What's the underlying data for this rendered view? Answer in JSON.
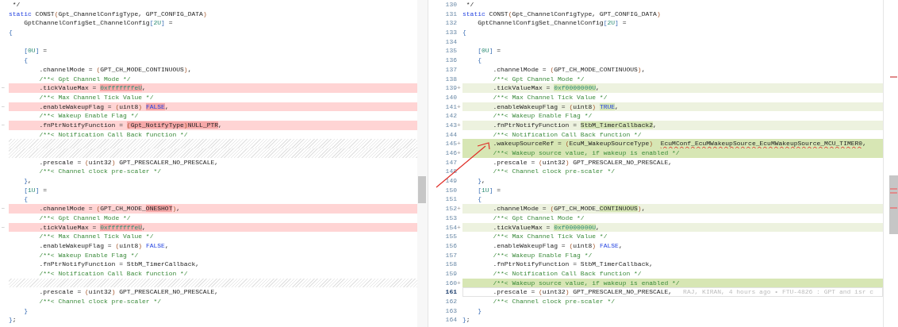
{
  "left_pane": {
    "lines": [
      {
        "kind": "plain",
        "text": " */"
      },
      {
        "kind": "plain",
        "text": "static CONST(Gpt_ChannelConfigType, GPT_CONFIG_DATA)"
      },
      {
        "kind": "plain",
        "text": "    GptChannelConfigSet_ChannelConfig[2U] ="
      },
      {
        "kind": "plain",
        "text": "{"
      },
      {
        "kind": "plain"
      },
      {
        "kind": "plain",
        "text": "    [0U] ="
      },
      {
        "kind": "plain",
        "text": "    {"
      },
      {
        "kind": "plain",
        "text": "        .channelMode = (GPT_CH_MODE_CONTINUOUS),"
      },
      {
        "kind": "plain",
        "text": "        /**< Gpt Channel Mode */"
      },
      {
        "marker": "—",
        "kind": "removed",
        "segments": [
          {
            "text": "        .tickValueMax = ",
            "changed": false
          },
          {
            "text": "0xfffffffeU",
            "changed": true
          },
          {
            "text": ",",
            "changed": false
          }
        ]
      },
      {
        "kind": "plain",
        "text": "        /**< Max Channel Tick Value */"
      },
      {
        "marker": "—",
        "kind": "removed",
        "segments": [
          {
            "text": "        .enableWakeupFlag = (uint8) ",
            "changed": false
          },
          {
            "text": "FALSE",
            "changed": true
          },
          {
            "text": ",",
            "changed": false
          }
        ]
      },
      {
        "kind": "plain",
        "text": "        /**< Wakeup Enable Flag */"
      },
      {
        "marker": "—",
        "kind": "removed",
        "segments": [
          {
            "text": "        .fnPtrNotifyFunction = ",
            "changed": false
          },
          {
            "text": "(Gpt_NotifyType)NULL_PTR",
            "changed": true
          },
          {
            "text": ",",
            "changed": false
          }
        ]
      },
      {
        "kind": "plain",
        "text": "        /**< Notification Call Back function */"
      },
      {
        "kind": "filler"
      },
      {
        "kind": "filler"
      },
      {
        "kind": "plain",
        "text": "        .prescale = (uint32) GPT_PRESCALER_NO_PRESCALE,"
      },
      {
        "kind": "plain",
        "text": "        /**< Channel clock pre-scaler */"
      },
      {
        "kind": "plain",
        "text": "    },"
      },
      {
        "kind": "plain",
        "text": "    [1U] ="
      },
      {
        "kind": "plain",
        "text": "    {"
      },
      {
        "marker": "—",
        "kind": "removed",
        "segments": [
          {
            "text": "        .channelMode = (GPT_CH_MODE_",
            "changed": false
          },
          {
            "text": "ONESHOT",
            "changed": true
          },
          {
            "text": "),",
            "changed": false
          }
        ]
      },
      {
        "kind": "plain",
        "text": "        /**< Gpt Channel Mode */"
      },
      {
        "marker": "—",
        "kind": "removed",
        "segments": [
          {
            "text": "        .tickValueMax = ",
            "changed": false
          },
          {
            "text": "0xfffffffeU",
            "changed": true
          },
          {
            "text": ",",
            "changed": false
          }
        ]
      },
      {
        "kind": "plain",
        "text": "        /**< Max Channel Tick Value */"
      },
      {
        "kind": "plain",
        "text": "        .enableWakeupFlag = (uint8) FALSE,"
      },
      {
        "kind": "plain",
        "text": "        /**< Wakeup Enable Flag */"
      },
      {
        "kind": "plain",
        "text": "        .fnPtrNotifyFunction = StbM_TimerCallback,"
      },
      {
        "kind": "plain",
        "text": "        /**< Notification Call Back function */"
      },
      {
        "kind": "filler"
      },
      {
        "kind": "plain",
        "text": "        .prescale = (uint32) GPT_PRESCALER_NO_PRESCALE,"
      },
      {
        "kind": "plain",
        "text": "        /**< Channel clock pre-scaler */"
      },
      {
        "kind": "plain",
        "text": "    }"
      },
      {
        "kind": "plain",
        "text": "};"
      }
    ]
  },
  "right_pane": {
    "lines": [
      {
        "number": "130",
        "kind": "plain",
        "text": " */"
      },
      {
        "number": "131",
        "kind": "plain",
        "text": "static CONST(Gpt_ChannelConfigType, GPT_CONFIG_DATA)"
      },
      {
        "number": "132",
        "kind": "plain",
        "text": "    GptChannelConfigSet_ChannelConfig[2U] ="
      },
      {
        "number": "133",
        "kind": "plain",
        "text": "{"
      },
      {
        "number": "134",
        "kind": "plain"
      },
      {
        "number": "135",
        "kind": "plain",
        "text": "    [0U] ="
      },
      {
        "number": "136",
        "kind": "plain",
        "text": "    {"
      },
      {
        "number": "137",
        "kind": "plain",
        "text": "        .channelMode = (GPT_CH_MODE_CONTINUOUS),"
      },
      {
        "number": "138",
        "kind": "plain",
        "text": "        /**< Gpt Channel Mode */"
      },
      {
        "number": "139",
        "marker": "+",
        "kind": "added",
        "segments": [
          {
            "text": "        .tickValueMax = ",
            "changed": false
          },
          {
            "text": "0xf0000000U",
            "changed": true
          },
          {
            "text": ",",
            "changed": false
          }
        ]
      },
      {
        "number": "140",
        "kind": "plain",
        "text": "        /**< Max Channel Tick Value */"
      },
      {
        "number": "141",
        "marker": "+",
        "kind": "added",
        "segments": [
          {
            "text": "        .enableWakeupFlag = (uint8) ",
            "changed": false
          },
          {
            "text": "TRUE",
            "changed": true
          },
          {
            "text": ",",
            "changed": false
          }
        ]
      },
      {
        "number": "142",
        "kind": "plain",
        "text": "        /**< Wakeup Enable Flag */"
      },
      {
        "number": "143",
        "marker": "+",
        "kind": "added",
        "segments": [
          {
            "text": "        .fnPtrNotifyFunction = ",
            "changed": false
          },
          {
            "text": "StbM_TimerCallback2",
            "changed": true
          },
          {
            "text": ",",
            "changed": false
          }
        ]
      },
      {
        "number": "144",
        "kind": "plain",
        "text": "        /**< Notification Call Back function */"
      },
      {
        "number": "145",
        "marker": "+",
        "kind": "inserted",
        "segments": [
          {
            "text": "        .wakeupSourceRef = (EcuM_WakeupSourceType)  "
          },
          {
            "text": "EcuMConf_EcuMWakeupSource_EcuMWakeupSource_MCU_TIMER0",
            "error": true
          },
          {
            "text": ","
          }
        ]
      },
      {
        "number": "146",
        "marker": "+",
        "kind": "inserted",
        "text": "        /**< Wakeup source value, if wakeup is enabled */"
      },
      {
        "number": "147",
        "kind": "plain",
        "text": "        .prescale = (uint32) GPT_PRESCALER_NO_PRESCALE,"
      },
      {
        "number": "148",
        "kind": "plain",
        "text": "        /**< Channel clock pre-scaler */"
      },
      {
        "number": "149",
        "kind": "plain",
        "text": "    },"
      },
      {
        "number": "150",
        "kind": "plain",
        "text": "    [1U] ="
      },
      {
        "number": "151",
        "kind": "plain",
        "text": "    {"
      },
      {
        "number": "152",
        "marker": "+",
        "kind": "added",
        "segments": [
          {
            "text": "        .channelMode = (GPT_CH_MODE_",
            "changed": false
          },
          {
            "text": "CONTINUOUS",
            "changed": true
          },
          {
            "text": "),",
            "changed": false
          }
        ]
      },
      {
        "number": "153",
        "kind": "plain",
        "text": "        /**< Gpt Channel Mode */"
      },
      {
        "number": "154",
        "marker": "+",
        "kind": "added",
        "segments": [
          {
            "text": "        .tickValueMax = ",
            "changed": false
          },
          {
            "text": "0xf0000000U",
            "changed": true
          },
          {
            "text": ",",
            "changed": false
          }
        ]
      },
      {
        "number": "155",
        "kind": "plain",
        "text": "        /**< Max Channel Tick Value */"
      },
      {
        "number": "156",
        "kind": "plain",
        "text": "        .enableWakeupFlag = (uint8) FALSE,"
      },
      {
        "number": "157",
        "kind": "plain",
        "text": "        /**< Wakeup Enable Flag */"
      },
      {
        "number": "158",
        "kind": "plain",
        "text": "        .fnPtrNotifyFunction = StbM_TimerCallback,"
      },
      {
        "number": "159",
        "kind": "plain",
        "text": "        /**< Notification Call Back function */"
      },
      {
        "number": "160",
        "marker": "+",
        "kind": "inserted",
        "text": "        /**< Wakeup source value, if wakeup is enabled */"
      },
      {
        "number": "161",
        "kind": "plain",
        "current": true,
        "text": "        .prescale = (uint32) GPT_PRESCALER_NO_PRESCALE,",
        "blame": "RAJ, KIRAN, 4 hours ago • FTU-4826 : GPT and isr c"
      },
      {
        "number": "162",
        "kind": "plain",
        "text": "        /**< Channel clock pre-scaler */"
      },
      {
        "number": "163",
        "kind": "plain",
        "text": "    }"
      },
      {
        "number": "164",
        "kind": "plain",
        "text": "};"
      }
    ]
  }
}
